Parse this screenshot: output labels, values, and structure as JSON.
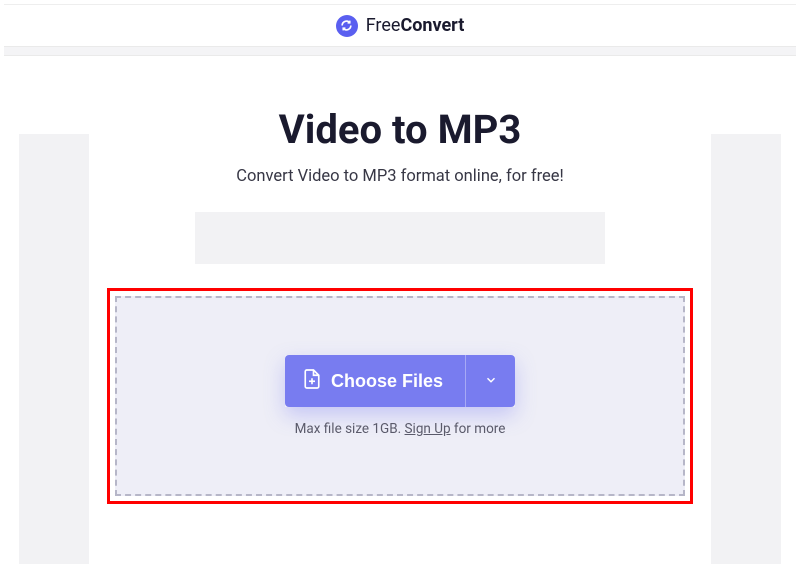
{
  "header": {
    "logo_free": "Free",
    "logo_convert": "Convert"
  },
  "main": {
    "title": "Video to MP3",
    "subtitle": "Convert Video to MP3 format online, for free!"
  },
  "dropzone": {
    "choose_files_label": "Choose Files",
    "hint_prefix": "Max file size 1GB. ",
    "signup_label": "Sign Up",
    "hint_suffix": " for more"
  }
}
